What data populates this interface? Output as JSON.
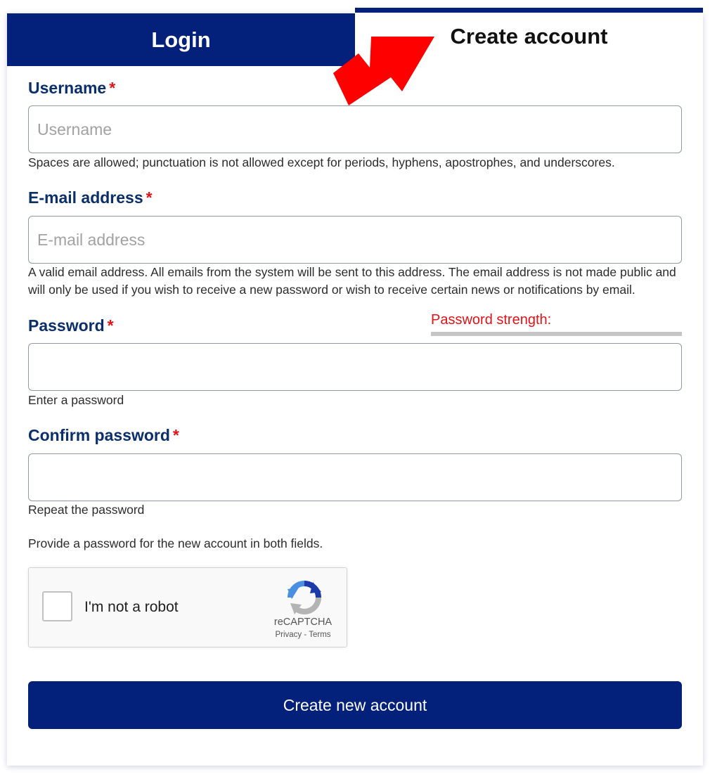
{
  "tabs": {
    "login": "Login",
    "create_account": "Create account",
    "active": "create_account"
  },
  "colors": {
    "brand": "#03207a",
    "label": "#0a2f6b",
    "required": "#e01418",
    "annotation_arrow": "#ff0000"
  },
  "form": {
    "required_marker": "*",
    "username": {
      "label": "Username",
      "placeholder": "Username",
      "value": "",
      "help": "Spaces are allowed; punctuation is not allowed except for periods, hyphens, apostrophes, and underscores."
    },
    "email": {
      "label": "E-mail address",
      "placeholder": "E-mail address",
      "value": "",
      "help": "A valid email address. All emails from the system will be sent to this address. The email address is not made public and will only be used if you wish to receive a new password or wish to receive certain news or notifications by email."
    },
    "password": {
      "label": "Password",
      "value": "",
      "help": "Enter a password",
      "strength_label": "Password strength:",
      "strength_level": 0
    },
    "confirm_password": {
      "label": "Confirm password",
      "value": "",
      "help": "Repeat the password"
    },
    "password_hint": "Provide a password for the new account in both fields."
  },
  "captcha": {
    "label": "I'm not a robot",
    "checked": false,
    "brand": "reCAPTCHA",
    "privacy": "Privacy",
    "separator": "-",
    "terms": "Terms"
  },
  "submit_label": "Create new account"
}
